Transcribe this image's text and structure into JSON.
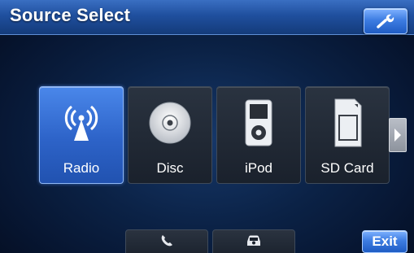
{
  "header": {
    "title": "Source Select"
  },
  "sources": [
    {
      "label": "Radio",
      "icon": "radio-antenna-icon",
      "selected": true
    },
    {
      "label": "Disc",
      "icon": "disc-icon",
      "selected": false
    },
    {
      "label": "iPod",
      "icon": "ipod-icon",
      "selected": false
    },
    {
      "label": "SD Card",
      "icon": "sd-card-icon",
      "selected": false
    }
  ],
  "navigation": {
    "next_icon": "chevron-right-icon",
    "settings_icon": "wrench-icon"
  },
  "bottom_tiles": [
    {
      "icon": "phone-icon"
    },
    {
      "icon": "car-icon"
    }
  ],
  "footer": {
    "exit_label": "Exit"
  },
  "colors": {
    "accent": "#2d63c8",
    "header": "#1f4f9e",
    "background": "#0b2246"
  }
}
